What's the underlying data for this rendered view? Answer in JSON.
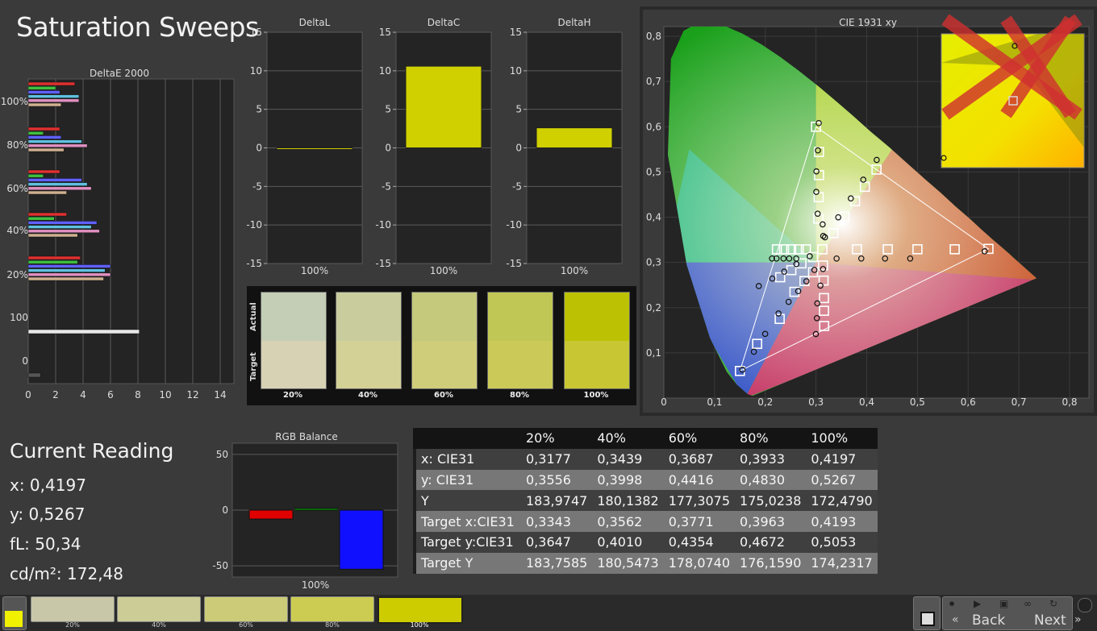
{
  "title": "Saturation Sweeps",
  "colors": {
    "accent": "#d4d400",
    "bar_yellow": "#d0d000",
    "red": "#e00000",
    "green": "#00b000",
    "blue": "#1010ff"
  },
  "deltae": {
    "title": "DeltaE 2000",
    "ticks": [
      "0",
      "2",
      "4",
      "6",
      "8",
      "10",
      "12",
      "14"
    ],
    "group_labels": [
      "100%",
      "80%",
      "60%",
      "40%",
      "20%",
      "100",
      "0"
    ]
  },
  "panels": [
    {
      "title": "DeltaL",
      "value": -0.15,
      "xlabel": "100%",
      "ticks": [
        "15",
        "10",
        "5",
        "0",
        "-5",
        "-10",
        "-15"
      ]
    },
    {
      "title": "DeltaC",
      "value": 10.6,
      "xlabel": "100%",
      "ticks": [
        "15",
        "10",
        "5",
        "0",
        "-5",
        "-10",
        "-15"
      ]
    },
    {
      "title": "DeltaH",
      "value": 2.6,
      "xlabel": "100%",
      "ticks": [
        "15",
        "10",
        "5",
        "0",
        "-5",
        "-10",
        "-15"
      ]
    }
  ],
  "swatches": {
    "actual_label": "Actual",
    "target_label": "Target",
    "items": [
      {
        "label": "20%",
        "actual": "#c4cdb5",
        "target": "#d7d2b4"
      },
      {
        "label": "40%",
        "actual": "#c9cd9e",
        "target": "#d4d197"
      },
      {
        "label": "60%",
        "actual": "#c4c97c",
        "target": "#d0cd7a"
      },
      {
        "label": "80%",
        "actual": "#c1c754",
        "target": "#cbc957"
      },
      {
        "label": "100%",
        "actual": "#bcc104",
        "target": "#c8c632"
      }
    ]
  },
  "cie": {
    "title": "CIE 1931 xy",
    "xticks": [
      "0",
      "0,1",
      "0,2",
      "0,3",
      "0,4",
      "0,5",
      "0,6",
      "0,7",
      "0,8"
    ],
    "yticks": [
      "0,1",
      "0,2",
      "0,3",
      "0,4",
      "0,5",
      "0,6",
      "0,7",
      "0,8"
    ]
  },
  "current": {
    "title": "Current Reading",
    "x": "x: 0,4197",
    "y": "y: 0,5267",
    "fl": "fL: 50,34",
    "cd": "cd/m²: 172,48"
  },
  "rgb": {
    "title": "RGB Balance",
    "ticks": [
      "50",
      "0",
      "-50"
    ],
    "xlabel": "100%",
    "red": -8,
    "green": 1.5,
    "blue": -53
  },
  "table": {
    "headers": [
      "",
      "20%",
      "40%",
      "60%",
      "80%",
      "100%"
    ],
    "rows": [
      [
        "x: CIE31",
        "0,3177",
        "0,3439",
        "0,3687",
        "0,3933",
        "0,4197"
      ],
      [
        "y: CIE31",
        "0,3556",
        "0,3998",
        "0,4416",
        "0,4830",
        "0,5267"
      ],
      [
        "Y",
        "183,9747",
        "180,1382",
        "177,3075",
        "175,0238",
        "172,4790"
      ],
      [
        "Target x:CIE31",
        "0,3343",
        "0,3562",
        "0,3771",
        "0,3963",
        "0,4193"
      ],
      [
        "Target y:CIE31",
        "0,3647",
        "0,4010",
        "0,4354",
        "0,4672",
        "0,5053"
      ],
      [
        "Target Y",
        "183,7585",
        "180,5473",
        "178,0740",
        "176,1590",
        "174,2317"
      ]
    ]
  },
  "toolbar": {
    "swatches": [
      {
        "label": "20%",
        "color": "#c8c8a8"
      },
      {
        "label": "40%",
        "color": "#cccc96"
      },
      {
        "label": "60%",
        "color": "#cccc78"
      },
      {
        "label": "80%",
        "color": "#cccc52"
      },
      {
        "label": "100%",
        "color": "#cccc00"
      }
    ],
    "back": "Back",
    "next": "Next"
  },
  "chart_data": [
    {
      "type": "bar",
      "title": "DeltaE 2000",
      "orientation": "horizontal",
      "xlim": [
        0,
        15
      ],
      "categories": [
        "100%",
        "80%",
        "60%",
        "40%",
        "20%",
        "100",
        "0"
      ],
      "series": [
        {
          "values": [
            3.4,
            2.0,
            2.3,
            3.7,
            3.7,
            2.4
          ]
        },
        {
          "values": [
            2.3,
            1.1,
            2.4,
            3.9,
            4.3,
            2.6
          ]
        },
        {
          "values": [
            2.3,
            1.1,
            3.9,
            4.3,
            4.6,
            2.8
          ]
        },
        {
          "values": [
            2.8,
            1.9,
            5.0,
            4.6,
            5.2,
            3.6
          ]
        },
        {
          "values": [
            3.8,
            3.6,
            6.0,
            5.6,
            6.0,
            5.5
          ]
        },
        {
          "values": [
            8.1
          ]
        },
        {
          "values": [
            0.9
          ]
        }
      ]
    },
    {
      "type": "bar",
      "title": "DeltaL",
      "categories": [
        "100%"
      ],
      "values": [
        -0.15
      ],
      "ylim": [
        -15,
        15
      ]
    },
    {
      "type": "bar",
      "title": "DeltaC",
      "categories": [
        "100%"
      ],
      "values": [
        10.6
      ],
      "ylim": [
        -15,
        15
      ]
    },
    {
      "type": "bar",
      "title": "DeltaH",
      "categories": [
        "100%"
      ],
      "values": [
        2.6
      ],
      "ylim": [
        -15,
        15
      ]
    },
    {
      "type": "scatter",
      "title": "CIE 1931 xy",
      "xlim": [
        0,
        0.8
      ],
      "ylim": [
        0,
        0.85
      ],
      "series": [
        {
          "values": [
            [
              0.3177,
              0.3556
            ],
            [
              0.3439,
              0.3998
            ],
            [
              0.3687,
              0.4416
            ],
            [
              0.3933,
              0.483
            ],
            [
              0.4197,
              0.5267
            ],
            [
              0.2877,
              0.3137
            ],
            [
              0.2613,
              0.2964
            ],
            [
              0.2374,
              0.2796
            ],
            [
              0.2139,
              0.2644
            ],
            [
              0.1872,
              0.2478
            ],
            [
              0.2969,
              0.2834
            ],
            [
              0.2811,
              0.2584
            ],
            [
              0.2649,
              0.2366
            ],
            [
              0.246,
              0.2129
            ],
            [
              0.2261,
              0.1872
            ],
            [
              0.3033,
              0.4078
            ],
            [
              0.3006,
              0.4561
            ],
            [
              0.3008,
              0.5013
            ],
            [
              0.3037,
              0.5478
            ],
            [
              0.3054,
              0.6081
            ],
            [
              0.3406,
              0.3087
            ],
            [
              0.3893,
              0.3087
            ],
            [
              0.4362,
              0.3087
            ],
            [
              0.4857,
              0.3087
            ],
            [
              0.6326,
              0.3246
            ],
            [
              0.3139,
              0.2855
            ],
            [
              0.3087,
              0.2488
            ],
            [
              0.3025,
              0.2095
            ],
            [
              0.3017,
              0.1768
            ],
            [
              0.2997,
              0.1416
            ],
            [
              0.2133,
              0.3087
            ],
            [
              0.2222,
              0.3087
            ],
            [
              0.2359,
              0.3087
            ],
            [
              0.2472,
              0.3087
            ],
            [
              0.261,
              0.3087
            ],
            [
              0.3143,
              0.3585
            ],
            [
              0.3131,
              0.3841
            ],
            [
              0.155,
              0.0627
            ],
            [
              0.1775,
              0.1025
            ],
            [
              0.1998,
              0.142
            ]
          ]
        },
        {
          "values": [
            [
              0.3343,
              0.3647
            ],
            [
              0.3562,
              0.401
            ],
            [
              0.3771,
              0.4354
            ],
            [
              0.3963,
              0.4672
            ],
            [
              0.4193,
              0.5053
            ],
            [
              0.2944,
              0.3119
            ],
            [
              0.2713,
              0.2979
            ],
            [
              0.2514,
              0.283
            ],
            [
              0.2294,
              0.2672
            ],
            [
              0.15,
              0.06
            ],
            [
              0.2943,
              0.2783
            ],
            [
              0.2773,
              0.2589
            ],
            [
              0.2575,
              0.235
            ],
            [
              0.2284,
              0.1751
            ],
            [
              0.184,
              0.12
            ],
            [
              0.3046,
              0.3971
            ],
            [
              0.3053,
              0.4443
            ],
            [
              0.306,
              0.493
            ],
            [
              0.3059,
              0.5442
            ],
            [
              0.3,
              0.6
            ],
            [
              0.3807,
              0.3291
            ],
            [
              0.4415,
              0.3291
            ],
            [
              0.5,
              0.3291
            ],
            [
              0.5735,
              0.3291
            ],
            [
              0.64,
              0.33
            ],
            [
              0.3139,
              0.2933
            ],
            [
              0.315,
              0.2599
            ],
            [
              0.3157,
              0.2212
            ],
            [
              0.3158,
              0.1931
            ],
            [
              0.3161,
              0.1594
            ],
            [
              0.223,
              0.329
            ],
            [
              0.237,
              0.329
            ],
            [
              0.251,
              0.329
            ],
            [
              0.266,
              0.329
            ],
            [
              0.28,
              0.329
            ],
            [
              0.3127,
              0.329
            ]
          ]
        }
      ]
    },
    {
      "type": "bar",
      "title": "RGB Balance",
      "categories": [
        "100%"
      ],
      "ylim": [
        -60,
        60
      ],
      "series": [
        {
          "name": "R",
          "values": [
            -8
          ]
        },
        {
          "name": "G",
          "values": [
            1.5
          ]
        },
        {
          "name": "B",
          "values": [
            -53
          ]
        }
      ]
    }
  ]
}
